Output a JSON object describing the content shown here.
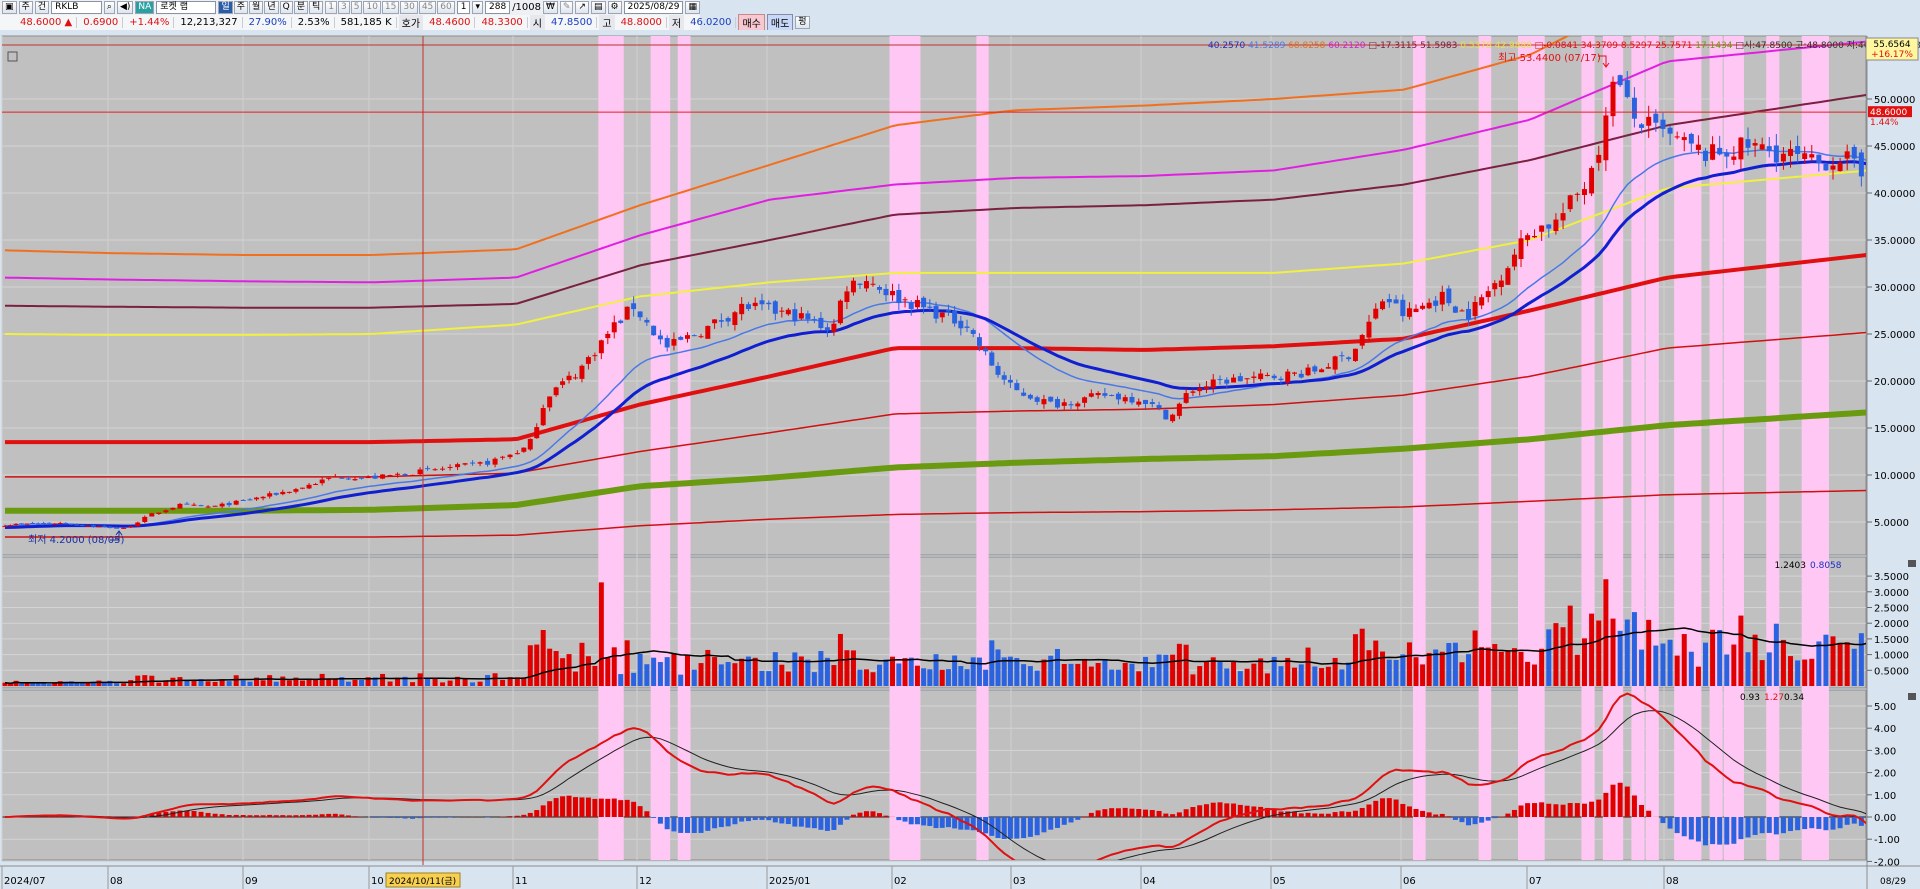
{
  "toolbar": {
    "market": "주",
    "type": "건",
    "symbol": "RKLB",
    "na_badge": "NA",
    "name": "로켓 랩",
    "periods": [
      "일",
      "주",
      "월",
      "년",
      "Q",
      "분",
      "틱"
    ],
    "minutes": [
      "1",
      "3",
      "5",
      "10",
      "15",
      "30",
      "45",
      "60"
    ],
    "count_value": "1",
    "bar_count": "288",
    "bar_total": "/1008",
    "date": "2025/08/29"
  },
  "quote": {
    "price": "48.6000 ▲",
    "change": "0.6900",
    "change_pct": "+1.44%",
    "volume": "12,213,327",
    "turnover_pct": "27.90%",
    "vol_ratio": "2.53%",
    "amount": "581,185 K",
    "ask_label": "호가",
    "ask": "48.4600",
    "bid": "48.3300",
    "open_label": "시",
    "open": "47.8500",
    "high_label": "고",
    "high": "48.8000",
    "low_label": "저",
    "low": "46.0200",
    "buy": "매수",
    "sell": "매도",
    "flat": "펑"
  },
  "indicator_line": [
    {
      "text": "40.2570",
      "color": "#1a2fc0"
    },
    {
      "text": "41.5289",
      "color": "#4a78e8"
    },
    {
      "text": "68.8258",
      "color": "#e07020"
    },
    {
      "text": "60.2120",
      "color": "#d020d0"
    },
    {
      "text": "□-17.3115",
      "color": "#7a2040"
    },
    {
      "text": "51.5983",
      "color": "#7a2040"
    },
    {
      "text": "0.5378",
      "color": "#e8e040"
    },
    {
      "text": "42.9888",
      "color": "#e8e040"
    },
    {
      "text": "□-0.0841",
      "color": "#e01010"
    },
    {
      "text": "34.3709",
      "color": "#e01010"
    },
    {
      "text": "8.5297",
      "color": "#e01010"
    },
    {
      "text": "25.7571",
      "color": "#e01010"
    },
    {
      "text": "17.1434",
      "color": "#6a9a10"
    },
    {
      "text": "□시:47.8500 고:48.8000 저:46.0200 종:48.6000",
      "color": "#303030"
    }
  ],
  "price_pane": {
    "axis_ticks": [
      "50.0000",
      "45.0000",
      "40.0000",
      "35.0000",
      "30.0000",
      "25.0000",
      "20.0000",
      "15.0000",
      "10.0000",
      "5.0000"
    ],
    "current_price": "48.6000",
    "current_pct": "1.44%",
    "target_price": "55.6564",
    "target_pct": "+16.17%",
    "high_marker": "최고 53.4400 (07/17)",
    "low_marker": "최저 4.2000 (08/05)"
  },
  "volume_pane": {
    "values_label": "1.2403",
    "values_label2": "0.8058",
    "axis_ticks": [
      "3.5000",
      "3.0000",
      "2.5000",
      "2.0000",
      "1.5000",
      "1.0000",
      "0.5000"
    ]
  },
  "macd_pane": {
    "v1": "0.93",
    "v2": "1.27",
    "v3": "0.34",
    "axis_ticks": [
      "5.00",
      "4.00",
      "3.00",
      "2.00",
      "1.00",
      "0.00",
      "-1.00",
      "-2.00"
    ]
  },
  "date_axis": {
    "months": [
      "2024/07",
      "08",
      "09",
      "10",
      "11",
      "12",
      "2025/01",
      "02",
      "03",
      "04",
      "05",
      "06",
      "07",
      "08"
    ],
    "crosshair_label": "2024/10/11(금)",
    "last_label": "08/29"
  },
  "colors": {
    "up": "#e00000",
    "down": "#2a62e0",
    "pane": "#c0c0c0",
    "highlight": "#ffc8f4"
  },
  "chart_data": {
    "type": "candlestick",
    "bars": 288,
    "close_keypoints_by_month": [
      [
        0,
        4.7
      ],
      [
        0.5,
        4.9
      ],
      [
        1.1,
        4.3
      ],
      [
        1.3,
        5.8
      ],
      [
        1.5,
        6.8
      ],
      [
        1.75,
        6.6
      ],
      [
        2.0,
        7.3
      ],
      [
        2.4,
        8.5
      ],
      [
        2.7,
        9.8
      ],
      [
        3.0,
        9.7
      ],
      [
        3.4,
        10.5
      ],
      [
        3.8,
        11.3
      ],
      [
        4.1,
        13
      ],
      [
        4.25,
        18.5
      ],
      [
        4.5,
        21
      ],
      [
        4.8,
        26
      ],
      [
        4.95,
        28
      ],
      [
        5.2,
        23.5
      ],
      [
        5.5,
        25.5
      ],
      [
        5.8,
        28
      ],
      [
        6.2,
        27
      ],
      [
        6.5,
        25.5
      ],
      [
        6.6,
        30
      ],
      [
        6.75,
        31
      ],
      [
        7.0,
        29
      ],
      [
        7.3,
        27.5
      ],
      [
        7.6,
        26
      ],
      [
        7.85,
        21
      ],
      [
        8.0,
        19
      ],
      [
        8.3,
        17.5
      ],
      [
        8.7,
        18.5
      ],
      [
        9.0,
        18
      ],
      [
        9.2,
        16
      ],
      [
        9.35,
        19
      ],
      [
        9.6,
        20
      ],
      [
        10.0,
        20.5
      ],
      [
        10.3,
        21
      ],
      [
        10.6,
        23
      ],
      [
        10.85,
        29
      ],
      [
        11.0,
        27
      ],
      [
        11.3,
        29
      ],
      [
        11.5,
        27
      ],
      [
        11.7,
        30
      ],
      [
        11.85,
        33
      ],
      [
        12.0,
        36
      ],
      [
        12.2,
        37
      ],
      [
        12.4,
        41
      ],
      [
        12.55,
        47
      ],
      [
        12.6,
        53
      ],
      [
        12.75,
        48
      ],
      [
        13.0,
        46
      ],
      [
        13.3,
        44
      ],
      [
        13.6,
        45
      ],
      [
        13.9,
        44
      ],
      [
        14.1,
        43
      ],
      [
        14.3,
        44
      ],
      [
        14.5,
        40.5
      ],
      [
        14.7,
        46
      ],
      [
        14.95,
        48.6
      ]
    ],
    "bands_by_month": {
      "orange": [
        33.9,
        33.6,
        33.4,
        33.4,
        34,
        38.7,
        43,
        47.2,
        48.8,
        49.3,
        50,
        51,
        54.7,
        62,
        70
      ],
      "magenta": [
        31,
        30.8,
        30.6,
        30.5,
        31,
        35.5,
        39.3,
        40.9,
        41.6,
        41.8,
        42.4,
        44.6,
        47.8,
        54,
        56.8
      ],
      "maroon": [
        28,
        27.9,
        27.8,
        27.8,
        28.2,
        32.3,
        35,
        37.7,
        38.4,
        38.7,
        39.3,
        40.9,
        43.5,
        47.2,
        51.5
      ],
      "yellow": [
        25,
        24.9,
        24.9,
        25,
        26,
        29,
        30.5,
        31.5,
        31.5,
        31.5,
        31.5,
        32.5,
        35,
        40.5,
        43
      ],
      "red_thick": [
        13.5,
        13.5,
        13.5,
        13.5,
        13.8,
        17.5,
        20.5,
        23.5,
        23.5,
        23.3,
        23.7,
        24.5,
        27.5,
        31,
        34.2
      ],
      "red_upper": [
        9.8,
        9.8,
        9.8,
        9.8,
        10.2,
        12.5,
        14.5,
        16.5,
        16.8,
        17,
        17.5,
        18.5,
        20.5,
        23.5,
        25.7
      ],
      "red_lower": [
        3.4,
        3.4,
        3.4,
        3.4,
        3.6,
        4.6,
        5.3,
        5.8,
        6,
        6.1,
        6.3,
        6.6,
        7.2,
        7.9,
        8.5
      ],
      "green": [
        6.2,
        6.2,
        6.2,
        6.3,
        6.8,
        8.8,
        9.7,
        10.8,
        11.3,
        11.7,
        12,
        12.8,
        13.8,
        15.3,
        17.1
      ]
    },
    "signal_bar_ranges": [
      [
        90,
        93
      ],
      [
        98,
        100
      ],
      [
        102,
        103
      ],
      [
        134,
        138
      ],
      [
        148,
        149
      ],
      [
        213,
        214
      ],
      [
        223,
        224
      ],
      [
        229,
        232
      ],
      [
        238,
        239
      ],
      [
        241,
        243
      ],
      [
        245,
        246
      ],
      [
        247,
        248
      ],
      [
        251,
        254
      ],
      [
        256,
        257
      ],
      [
        258,
        260
      ],
      [
        264,
        265
      ],
      [
        269,
        270
      ],
      [
        270,
        272
      ]
    ]
  }
}
